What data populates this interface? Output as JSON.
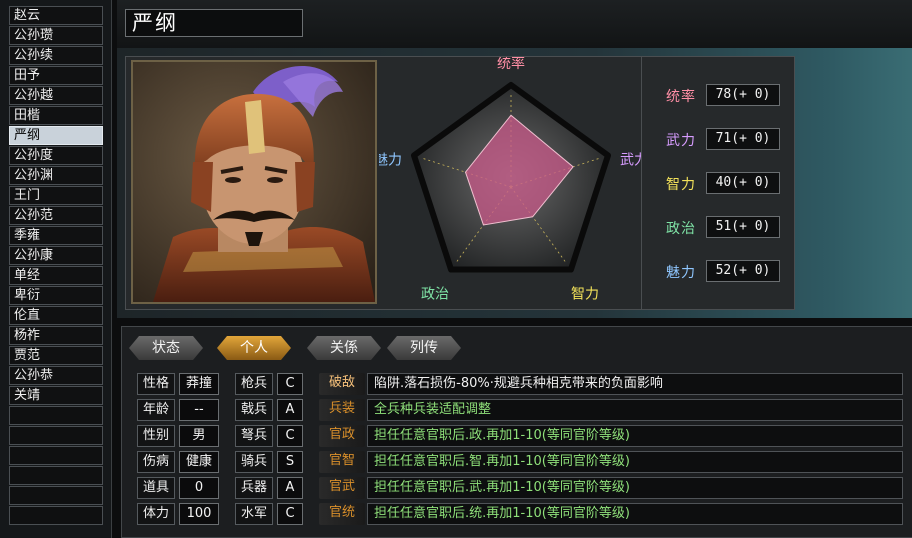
{
  "officers": [
    {
      "name": "赵云",
      "selected": false
    },
    {
      "name": "公孙瓒",
      "selected": false
    },
    {
      "name": "公孙续",
      "selected": false
    },
    {
      "name": "田予",
      "selected": false
    },
    {
      "name": "公孙越",
      "selected": false
    },
    {
      "name": "田楷",
      "selected": false
    },
    {
      "name": "严纲",
      "selected": true
    },
    {
      "name": "公孙度",
      "selected": false
    },
    {
      "name": "公孙渊",
      "selected": false
    },
    {
      "name": "王门",
      "selected": false
    },
    {
      "name": "公孙范",
      "selected": false
    },
    {
      "name": "季雍",
      "selected": false
    },
    {
      "name": "公孙康",
      "selected": false
    },
    {
      "name": "单经",
      "selected": false
    },
    {
      "name": "卑衍",
      "selected": false
    },
    {
      "name": "伦直",
      "selected": false
    },
    {
      "name": "杨祚",
      "selected": false
    },
    {
      "name": "贾范",
      "selected": false
    },
    {
      "name": "公孙恭",
      "selected": false
    },
    {
      "name": "关靖",
      "selected": false
    },
    {
      "name": "",
      "selected": false
    },
    {
      "name": "",
      "selected": false
    },
    {
      "name": "",
      "selected": false
    },
    {
      "name": "",
      "selected": false
    },
    {
      "name": "",
      "selected": false
    },
    {
      "name": "",
      "selected": false
    }
  ],
  "header": {
    "officer_name": "严纲"
  },
  "radar": {
    "axes": [
      {
        "label": "统率",
        "color": "#ff8fa6",
        "value": 78
      },
      {
        "label": "武力",
        "color": "#d79cff",
        "value": 71
      },
      {
        "label": "智力",
        "color": "#f3e25a",
        "value": 40
      },
      {
        "label": "政治",
        "color": "#7fe3a6",
        "value": 51
      },
      {
        "label": "魅力",
        "color": "#8fc6ff",
        "value": 52
      }
    ],
    "max": 100
  },
  "stats": [
    {
      "label": "统率",
      "value": "78(+ 0)",
      "color": "#ff8fa6"
    },
    {
      "label": "武力",
      "value": "71(+ 0)",
      "color": "#d79cff"
    },
    {
      "label": "智力",
      "value": "40(+ 0)",
      "color": "#f3e25a"
    },
    {
      "label": "政治",
      "value": "51(+ 0)",
      "color": "#7fe3a6"
    },
    {
      "label": "魅力",
      "value": "52(+ 0)",
      "color": "#8fc6ff"
    }
  ],
  "tabs": [
    {
      "label": "状态",
      "active": false
    },
    {
      "label": "个人",
      "active": true
    },
    {
      "label": "关係",
      "active": false
    },
    {
      "label": "列传",
      "active": false
    }
  ],
  "personal": [
    {
      "label": "性格",
      "value": "莽撞"
    },
    {
      "label": "年龄",
      "value": "--"
    },
    {
      "label": "性别",
      "value": "男"
    },
    {
      "label": "伤病",
      "value": "健康"
    },
    {
      "label": "道具",
      "value": "0"
    },
    {
      "label": "体力",
      "value": "100"
    }
  ],
  "aptitude": [
    {
      "label": "枪兵",
      "value": "C"
    },
    {
      "label": "戟兵",
      "value": "A"
    },
    {
      "label": "弩兵",
      "value": "C"
    },
    {
      "label": "骑兵",
      "value": "S"
    },
    {
      "label": "兵器",
      "value": "A"
    },
    {
      "label": "水军",
      "value": "C"
    }
  ],
  "skills": [
    {
      "name": "破敌",
      "name_color": "#f5c07a",
      "desc": "陷阱.落石损伤-80%·规避兵种相克带来的负面影响",
      "green": false
    },
    {
      "name": "兵装",
      "name_color": "#d98f2a",
      "desc": "全兵种兵装适配调整",
      "green": true
    },
    {
      "name": "官政",
      "name_color": "#d98f2a",
      "desc": "担任任意官职后.政.再加1-10(等同官阶等级)",
      "green": true
    },
    {
      "name": "官智",
      "name_color": "#d98f2a",
      "desc": "担任任意官职后.智.再加1-10(等同官阶等级)",
      "green": true
    },
    {
      "name": "官武",
      "name_color": "#d98f2a",
      "desc": "担任任意官职后.武.再加1-10(等同官阶等级)",
      "green": true
    },
    {
      "name": "官统",
      "name_color": "#d98f2a",
      "desc": "担任任意官职后.统.再加1-10(等同官阶等级)",
      "green": true
    }
  ]
}
